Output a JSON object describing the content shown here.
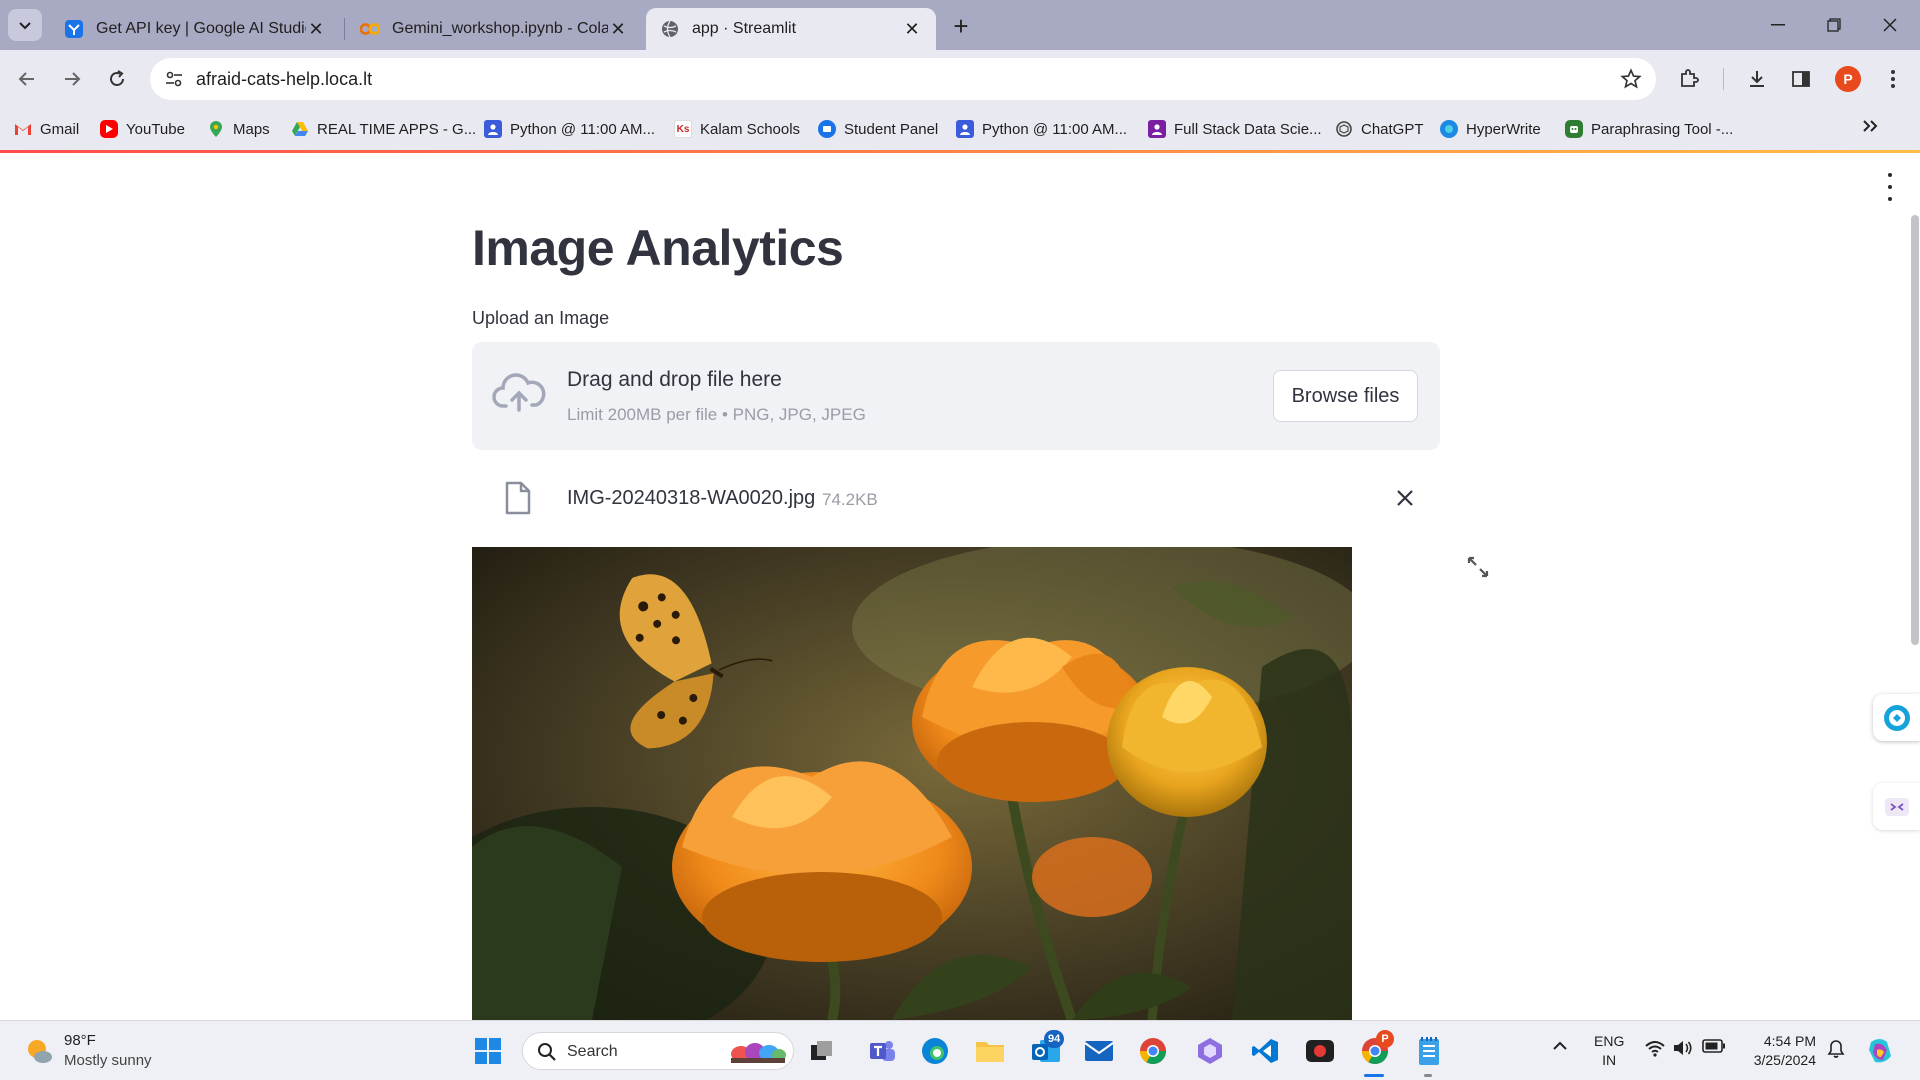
{
  "browser": {
    "tabs": [
      {
        "title": "Get API key | Google AI Studio",
        "favicon": "google-ai-studio-icon",
        "active": false
      },
      {
        "title": "Gemini_workshop.ipynb - Colab",
        "favicon": "colab-icon",
        "active": false
      },
      {
        "title": "app · Streamlit",
        "favicon": "globe-icon",
        "active": true
      }
    ],
    "url": "afraid-cats-help.loca.lt",
    "profile_initial": "P",
    "bookmarks": [
      {
        "label": "Gmail",
        "icon": "gmail-icon"
      },
      {
        "label": "YouTube",
        "icon": "youtube-icon"
      },
      {
        "label": "Maps",
        "icon": "maps-icon"
      },
      {
        "label": "REAL TIME APPS - G...",
        "icon": "drive-icon"
      },
      {
        "label": "Python @ 11:00 AM...",
        "icon": "contact-icon"
      },
      {
        "label": "Kalam Schools",
        "icon": "kalam-icon",
        "icon_text": "Ks"
      },
      {
        "label": "Student Panel",
        "icon": "student-panel-icon"
      },
      {
        "label": "Python @ 11:00 AM...",
        "icon": "contact-icon"
      },
      {
        "label": "Full Stack Data Scie...",
        "icon": "contact-icon"
      },
      {
        "label": "ChatGPT",
        "icon": "chatgpt-icon"
      },
      {
        "label": "HyperWrite",
        "icon": "hyperwrite-icon"
      },
      {
        "label": "Paraphrasing Tool -...",
        "icon": "paraphrasing-icon"
      }
    ]
  },
  "app": {
    "title": "Image Analytics",
    "uploader": {
      "label": "Upload an Image",
      "drop_title": "Drag and drop file here",
      "drop_subtitle": "Limit 200MB per file • PNG, JPG, JPEG",
      "browse_label": "Browse files"
    },
    "uploaded_file": {
      "name": "IMG-20240318-WA0020.jpg",
      "size": "74.2KB"
    },
    "preview_alt": "orange-flowers-with-butterfly-photo"
  },
  "taskbar": {
    "weather_temp": "98°F",
    "weather_desc": "Mostly sunny",
    "search_placeholder": "Search",
    "mail_badge": "94",
    "chrome_badge": "P",
    "language_line1": "ENG",
    "language_line2": "IN",
    "time": "4:54 PM",
    "date": "3/25/2024"
  },
  "colors": {
    "streamlit_red": "#ff4b4b",
    "streamlit_text": "#31333f",
    "dropzone_bg": "#f0f2f6",
    "tabbar_bg": "#a8a9c3",
    "toolbar_bg": "#e9e9f1"
  }
}
